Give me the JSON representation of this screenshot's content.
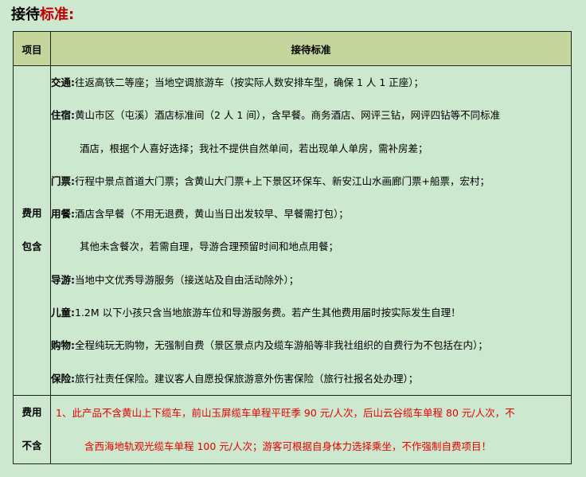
{
  "heading": {
    "part1": "接待",
    "part2": "标准:"
  },
  "table": {
    "header": {
      "col1": "项目",
      "col2": "接待标准"
    },
    "included": {
      "label_line1": "费用",
      "label_line2": "包含",
      "items": [
        {
          "key": "交通:",
          "text": "往返高铁二等座；当地空调旅游车（按实际人数安排车型，确保 1 人 1 正座）；"
        },
        {
          "key": "住宿:",
          "text": "黄山市区（屯溪）酒店标准间（2 人 1 间），含早餐。商务酒店、网评三钻，网评四钻等不同标准"
        },
        {
          "key": "",
          "text": "酒店，根据个人喜好选择；我社不提供自然单间，若出现单人单房，需补房差；"
        },
        {
          "key": "门票:",
          "text": "行程中景点首道大门票；含黄山大门票+上下景区环保车、新安江山水画廊门票+船票，宏村；"
        },
        {
          "key": "用餐:",
          "text": "酒店含早餐（不用无退费，黄山当日出发较早、早餐需打包）；"
        },
        {
          "key": "",
          "text": "其他未含餐次，若需自理，导游合理预留时间和地点用餐；"
        },
        {
          "key": "导游:",
          "text": "当地中文优秀导游服务（接送站及自由活动除外）；"
        },
        {
          "key": "儿童:",
          "text": "1.2M 以下小孩只含当地旅游车位和导游服务费。若产生其他费用届时按实际发生自理！"
        },
        {
          "key": "购物:",
          "text": "全程纯玩无购物，无强制自费（景区景点内及缆车游船等非我社组织的自费行为不包括在内）；"
        },
        {
          "key": "保险:",
          "text": "旅行社责任保险。建议客人自愿投保旅游意外伤害保险（旅行社报名处办理）；"
        }
      ]
    },
    "excluded": {
      "label_line1": "费用",
      "label_line2": "不含",
      "lines": [
        "1、此产品不含黄山上下缆车，前山玉屏缆车单程平旺季 90 元/人次，后山云谷缆车单程 80 元/人次，不",
        "含西海地轨观光缆车单程 100 元/人次；游客可根据自身体力选择乘坐，不作强制自费项目！"
      ]
    }
  }
}
